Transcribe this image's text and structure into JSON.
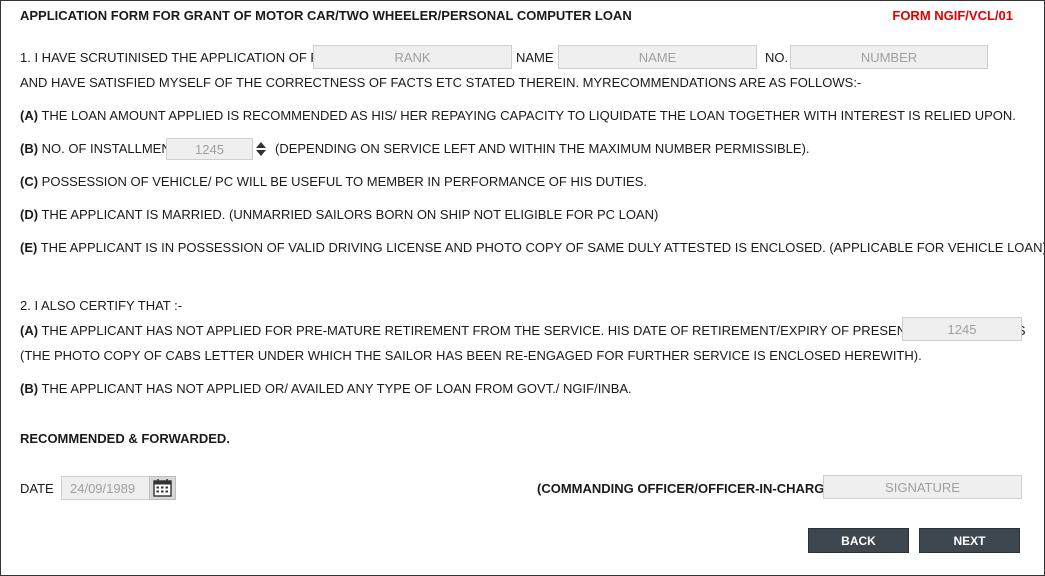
{
  "header": {
    "title": "APPLICATION FORM FOR GRANT OF MOTOR CAR/TWO WHEELER/PERSONAL COMPUTER LOAN",
    "form_code": "FORM NGIF/VCL/01"
  },
  "section1": {
    "intro_prefix": "1. I HAVE SCRUTINISED THE APPLICATION OF RANK",
    "rank_placeholder": "RANK",
    "name_label": "NAME",
    "name_placeholder": "NAME",
    "no_label": "NO.",
    "number_placeholder": "NUMBER",
    "intro_cont": "AND HAVE SATISFIED MYSELF OF THE CORRECTNESS OF FACTS ETC STATED THEREIN. MYRECOMMENDATIONS ARE AS FOLLOWS:-",
    "items": {
      "a_mark": "(A)",
      "a_text": "THE LOAN AMOUNT APPLIED IS RECOMMENDED AS HIS/ HER REPAYING CAPACITY TO LIQUIDATE THE LOAN TOGETHER WITH INTEREST IS RELIED UPON.",
      "b_mark": "(B)",
      "b_text": "NO. OF INSTALLMENT",
      "installment_value": "1245",
      "b_suffix": "(DEPENDING ON SERVICE LEFT AND WITHIN THE MAXIMUM NUMBER PERMISSIBLE).",
      "c_mark": "(C)",
      "c_text": "POSSESSION OF VEHICLE/ PC WILL BE USEFUL TO MEMBER IN PERFORMANCE OF HIS DUTIES.",
      "d_mark": "(D)",
      "d_text": "THE APPLICANT IS MARRIED. (UNMARRIED SAILORS BORN ON SHIP NOT ELIGIBLE FOR PC LOAN)",
      "e_mark": "(E)",
      "e_text": "THE APPLICANT IS IN POSSESSION OF VALID DRIVING LICENSE AND PHOTO COPY OF SAME DULY ATTESTED IS ENCLOSED. (APPLICABLE FOR VEHICLE LOAN)"
    }
  },
  "section2": {
    "heading": "2. I ALSO CERTIFY THAT :-",
    "a_mark": "(A)",
    "a_text": "THE APPLICANT HAS NOT APPLIED FOR PRE-MATURE RETIREMENT FROM THE SERVICE. HIS DATE OF RETIREMENT/EXPIRY OF PRESENT ENGAGEMENT IS",
    "retirement_value": "1245",
    "a_note": "(THE PHOTO COPY OF CABS LETTER UNDER WHICH THE SAILOR HAS BEEN RE-ENGAGED FOR FURTHER SERVICE IS ENCLOSED HEREWITH).",
    "b_mark": "(B)",
    "b_text": "THE APPLICANT HAS NOT APPLIED OR/ AVAILED ANY TYPE OF LOAN FROM GOVT./ NGIF/INBA."
  },
  "footer": {
    "recommended": "RECOMMENDED & FORWARDED.",
    "date_label": "DATE",
    "date_value": "24/09/1989",
    "officer_label": "(COMMANDING OFFICER/OFFICER-IN-CHARGE)",
    "signature_placeholder": "SIGNATURE",
    "back_label": "BACK",
    "next_label": "NEXT"
  },
  "icons": {
    "calendar": "calendar-icon",
    "spinner_up": "chevron-up-icon",
    "spinner_down": "chevron-down-icon"
  },
  "colors": {
    "form_code": "#e00000",
    "button_bg": "#3d4750",
    "field_bg": "#efefef"
  }
}
